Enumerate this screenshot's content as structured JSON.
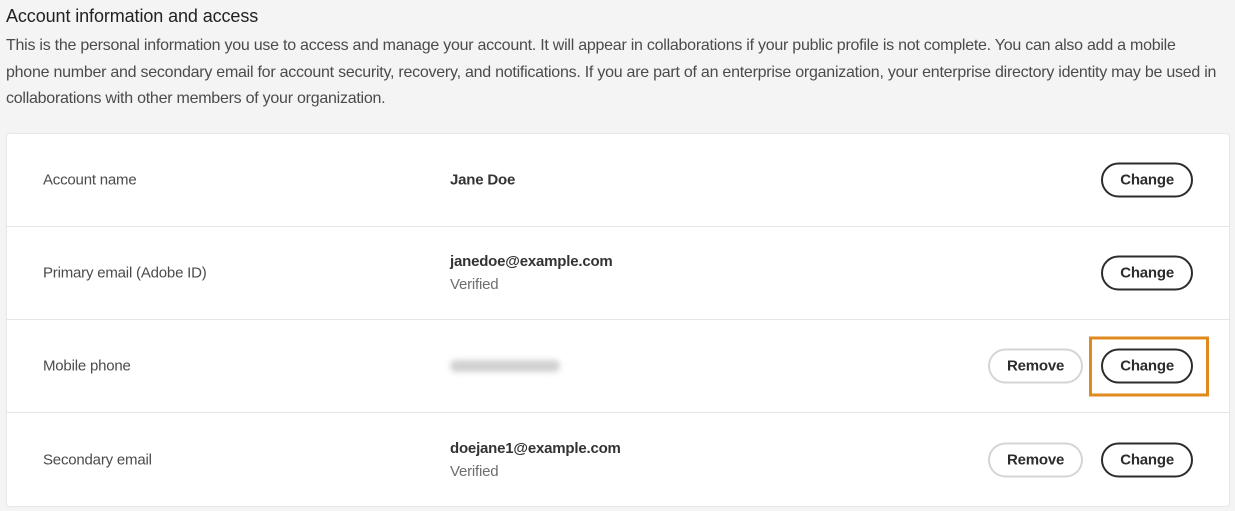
{
  "section": {
    "title": "Account information and access",
    "description": "This is the personal information you use to access and manage your account. It will appear in collaborations if your public profile is not complete. You can also add a mobile phone number and secondary email for account security, recovery, and notifications. If you are part of an enterprise organization, your enterprise directory identity may be used in collaborations with other members of your organization."
  },
  "rows": [
    {
      "label": "Account name",
      "value": "Jane Doe",
      "sub": null,
      "actions": {
        "change": "Change"
      }
    },
    {
      "label": "Primary email (Adobe ID)",
      "value": "janedoe@example.com",
      "sub": "Verified",
      "actions": {
        "change": "Change"
      }
    },
    {
      "label": "Mobile phone",
      "value": "[redacted phone number]",
      "sub": null,
      "actions": {
        "remove": "Remove",
        "change": "Change"
      },
      "highlighted_action": "change"
    },
    {
      "label": "Secondary email",
      "value": "doejane1@example.com",
      "sub": "Verified",
      "actions": {
        "remove": "Remove",
        "change": "Change"
      }
    }
  ],
  "colors": {
    "page_background": "#f4f4f4",
    "card_background": "#ffffff",
    "highlight": "#e08a1e",
    "button_border_primary": "#2c2c2c",
    "button_border_secondary": "#d5d5d5"
  }
}
